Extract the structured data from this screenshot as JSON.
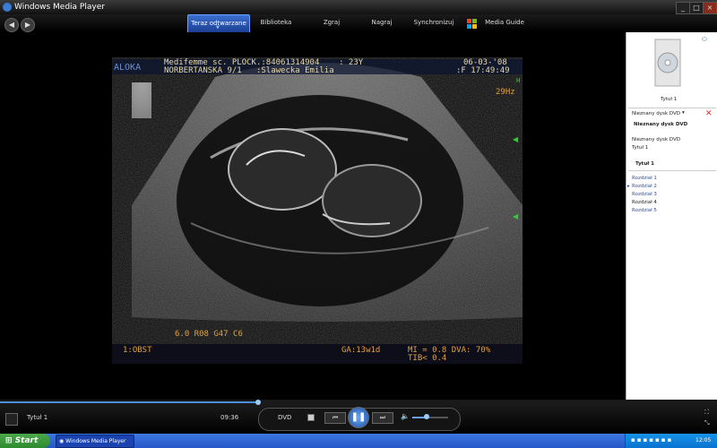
{
  "window": {
    "title": "Windows Media Player"
  },
  "nav": {
    "tabs": [
      {
        "label": "Teraz odtwarzane"
      },
      {
        "label": "Biblioteka"
      },
      {
        "label": "Zgraj"
      },
      {
        "label": "Nagraj"
      },
      {
        "label": "Synchronizuj"
      },
      {
        "label": "Media Guide"
      }
    ]
  },
  "video": {
    "brand": "ALOKA",
    "header_line1": "Medifemme sc. PLOCK.:84061314904    : 23Y",
    "header_line2": "NORBERTANSKA 9/1   :Slawecka Emilia",
    "date": "06-03-'08",
    "time": ":F 17:49:49",
    "rate": "29Hz",
    "marker_h": "H",
    "params": "6.0 R08 G47 C6",
    "mode": "1:OBST",
    "ga": "GA:13w1d",
    "mi": "MI = 0.8 DVA: 70%",
    "tib": "TIB< 0.4"
  },
  "panel": {
    "cover_label": "Tytuł 1",
    "disc_selector": "Nieznany dysk DVD",
    "disc_title": "Nieznany dysk DVD",
    "tree_disc": "Nieznany dysk DVD",
    "tree_title": "Tytuł 1",
    "title_heading": "Tytuł 1",
    "chapters": [
      "Rozdział 1",
      "Rozdział 2",
      "Rozdział 3",
      "Rozdział 4",
      "Rozdział 5"
    ]
  },
  "controls": {
    "now_playing": "Tytuł 1",
    "elapsed": "09:36",
    "source": "DVD",
    "seek_progress": 0.36,
    "volume_level": 0.4
  },
  "taskbar": {
    "start": "Start",
    "item": "Windows Media Player",
    "clock": "12:05"
  }
}
